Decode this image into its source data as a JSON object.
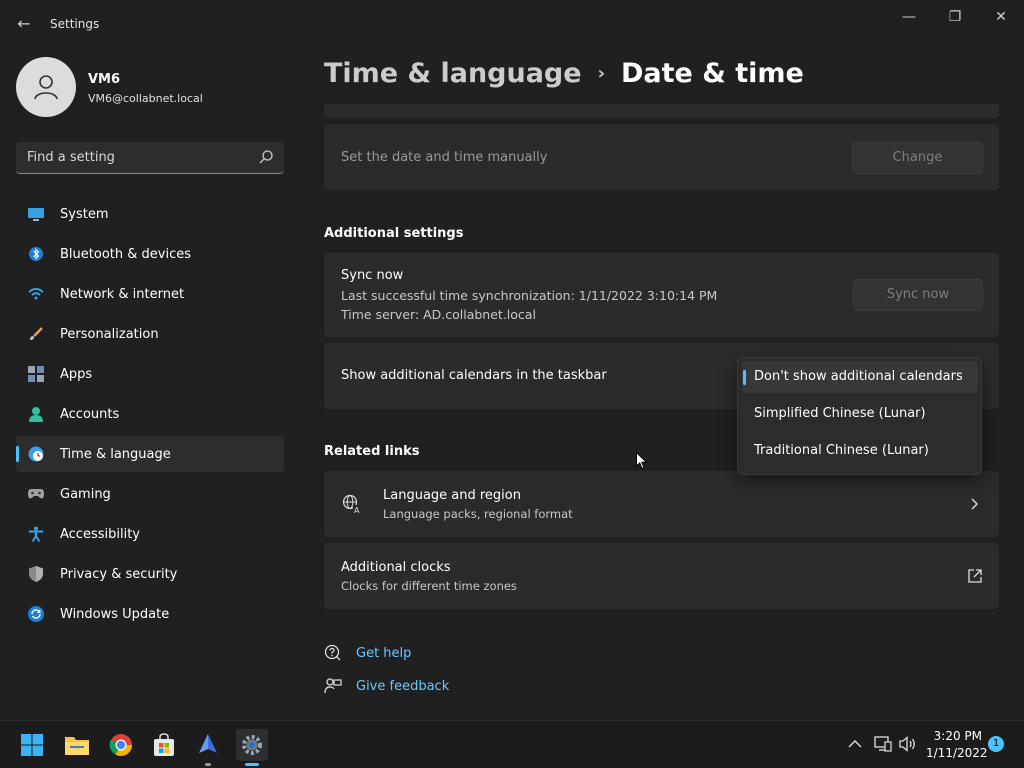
{
  "window": {
    "title": "Settings",
    "back_glyph": "←",
    "minimize_glyph": "—",
    "restore_glyph": "❐",
    "close_glyph": "✕"
  },
  "profile": {
    "name": "VM6",
    "email": "VM6@collabnet.local"
  },
  "search": {
    "placeholder": "Find a setting"
  },
  "sidebar": {
    "items": [
      {
        "label": "System",
        "icon": "monitor-icon"
      },
      {
        "label": "Bluetooth & devices",
        "icon": "bluetooth-icon"
      },
      {
        "label": "Network & internet",
        "icon": "wifi-icon"
      },
      {
        "label": "Personalization",
        "icon": "brush-icon"
      },
      {
        "label": "Apps",
        "icon": "apps-icon"
      },
      {
        "label": "Accounts",
        "icon": "person-icon"
      },
      {
        "label": "Time & language",
        "icon": "clock-globe-icon",
        "active": true
      },
      {
        "label": "Gaming",
        "icon": "gamepad-icon"
      },
      {
        "label": "Accessibility",
        "icon": "accessibility-icon"
      },
      {
        "label": "Privacy & security",
        "icon": "shield-icon"
      },
      {
        "label": "Windows Update",
        "icon": "update-icon"
      }
    ]
  },
  "header": {
    "parent": "Time & language",
    "separator": "›",
    "current": "Date & time"
  },
  "manual_time": {
    "label": "Set the date and time manually",
    "button": "Change"
  },
  "additional_settings": {
    "title": "Additional settings",
    "sync": {
      "title": "Sync now",
      "last_sync": "Last successful time synchronization: 1/11/2022 3:10:14 PM",
      "server": "Time server: AD.collabnet.local",
      "button": "Sync now"
    },
    "calendars": {
      "label": "Show additional calendars in the taskbar",
      "options": [
        "Don't show additional calendars",
        "Simplified Chinese (Lunar)",
        "Traditional Chinese (Lunar)"
      ],
      "selected_index": 0
    }
  },
  "related_links": {
    "title": "Related links",
    "language_region": {
      "title": "Language and region",
      "subtitle": "Language packs, regional format"
    },
    "additional_clocks": {
      "title": "Additional clocks",
      "subtitle": "Clocks for different time zones"
    }
  },
  "help": {
    "get_help": "Get help",
    "give_feedback": "Give feedback"
  },
  "taskbar": {
    "time": "3:20 PM",
    "date": "1/11/2022",
    "notifications": "1",
    "apps": [
      "start-icon",
      "file-explorer-icon",
      "chrome-icon",
      "store-icon",
      "app-icon",
      "settings-icon"
    ]
  },
  "colors": {
    "accent": "#4cc2ff",
    "background": "#202020",
    "card": "#2b2b2b",
    "taskbar": "#1c1c1c"
  }
}
